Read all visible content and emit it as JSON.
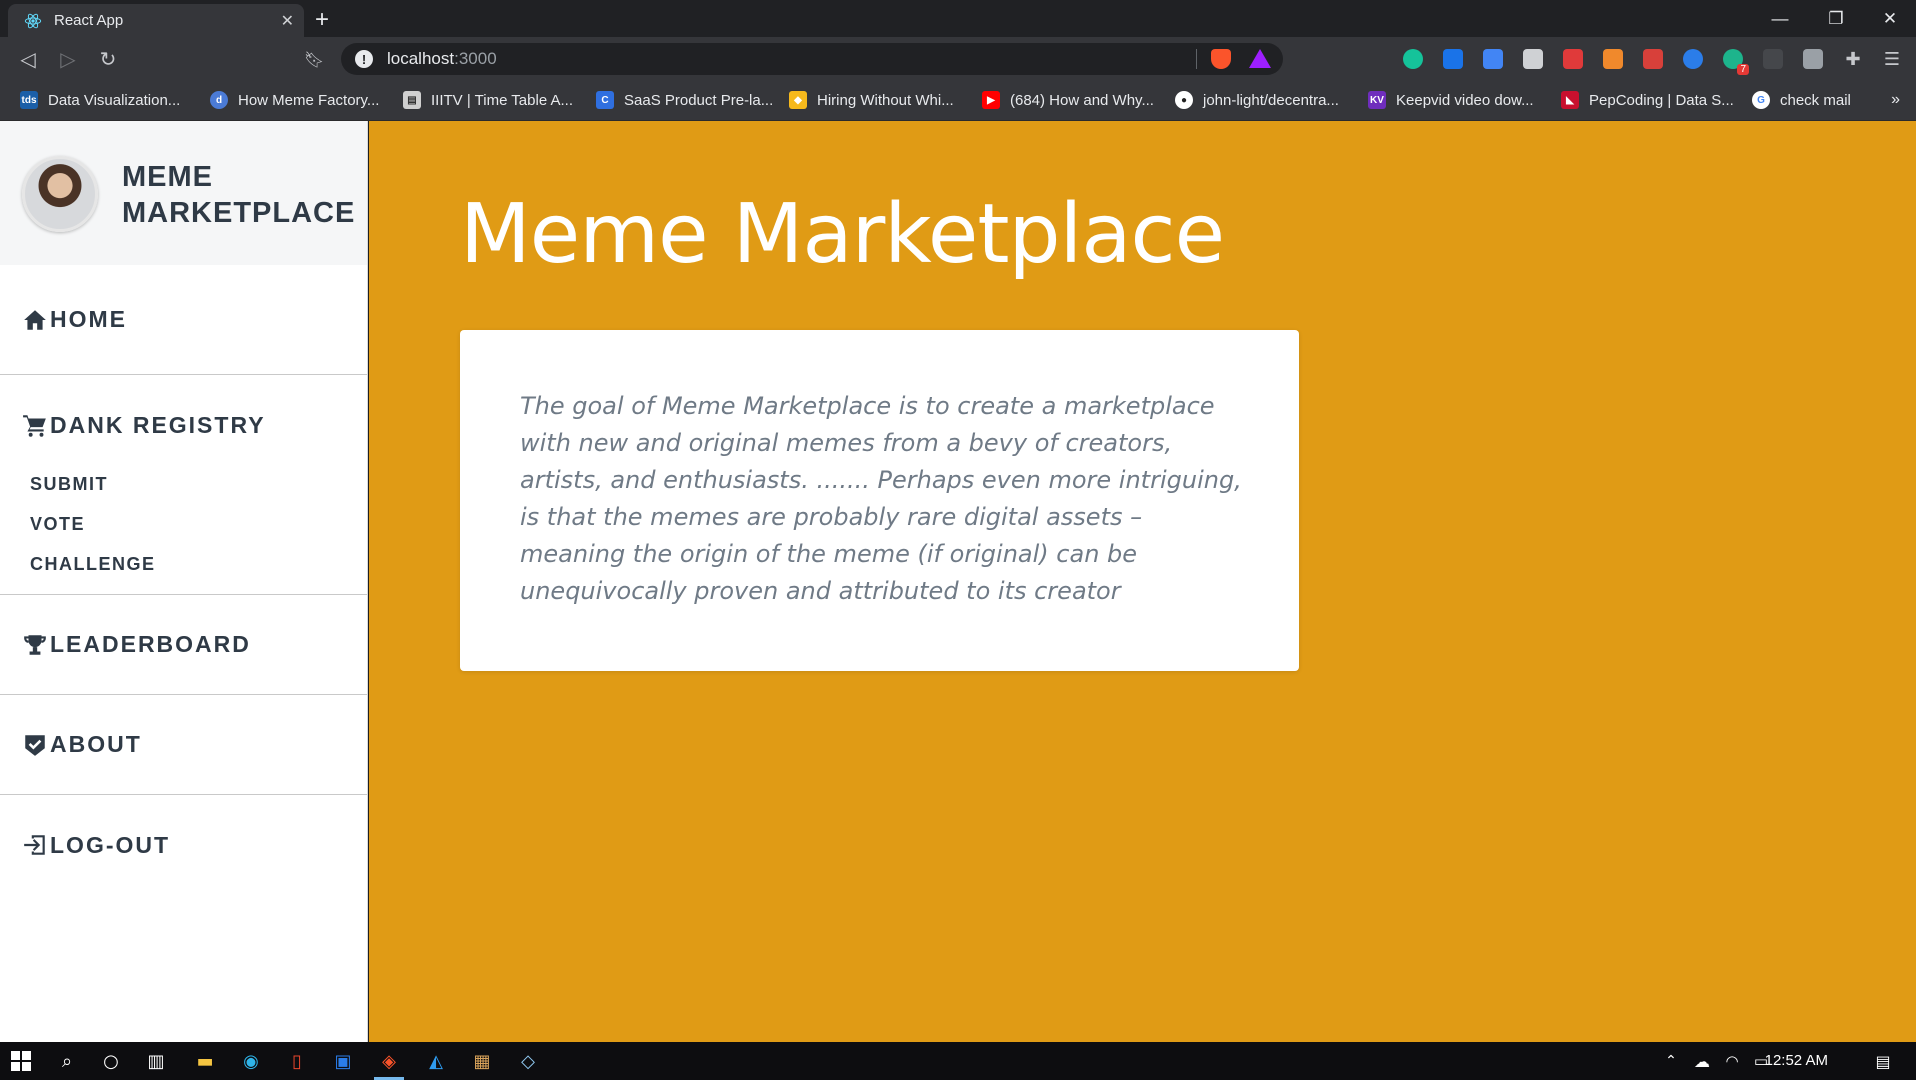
{
  "browser": {
    "tab_title": "React App",
    "new_tab_symbol": "+",
    "url_host": "localhost",
    "url_port": ":3000",
    "bookmarks": [
      {
        "label": "Data Visualization...",
        "icon": "tds-icon",
        "color": "#1b5fa8"
      },
      {
        "label": "How Meme Factory...",
        "icon": "d-icon",
        "color": "#4b7bd6"
      },
      {
        "label": "IIITV | Time Table A...",
        "icon": "doc-icon",
        "color": "#d0d0d0"
      },
      {
        "label": "SaaS Product Pre-la...",
        "icon": "c-icon",
        "color": "#2f6fe0"
      },
      {
        "label": "Hiring Without Whi...",
        "icon": "airtable-icon",
        "color": "#f6b91c"
      },
      {
        "label": "(684) How and Why...",
        "icon": "youtube-icon",
        "color": "#ff0000"
      },
      {
        "label": "john-light/decentra...",
        "icon": "github-icon",
        "color": "#ffffff"
      },
      {
        "label": "Keepvid video dow...",
        "icon": "kv-icon",
        "color": "#6f2dbd"
      },
      {
        "label": "PepCoding | Data S...",
        "icon": "pepcoding-icon",
        "color": "#c8102e"
      },
      {
        "label": "check mail",
        "icon": "google-icon",
        "color": "#ffffff"
      }
    ],
    "bookmarks_overflow": "»"
  },
  "app": {
    "brand": {
      "line1": "MEME",
      "line2": "MARKETPLACE"
    },
    "nav": {
      "home": "HOME",
      "dank_registry": "DANK REGISTRY",
      "submit": "SUBMIT",
      "vote": "VOTE",
      "challenge": "CHALLENGE",
      "leaderboard": "LEADERBOARD",
      "about": "ABOUT",
      "logout": "LOG-OUT"
    },
    "main": {
      "title": "Meme Marketplace",
      "description": "The goal of Meme Marketplace is to create a marketplace with new and original memes  from a bevy of creators, artists, and enthusiasts. ....... Perhaps even more intriguing, is that the memes are probably rare digital assets – meaning the origin of the meme  (if original) can be unequivocally proven and attributed to its creator"
    },
    "colors": {
      "accent": "#e09b15",
      "sidebar_text": "#2f3a46",
      "card_text": "#6f7a86"
    }
  },
  "taskbar": {
    "time": "12:52 AM",
    "notification_badge": "7"
  }
}
